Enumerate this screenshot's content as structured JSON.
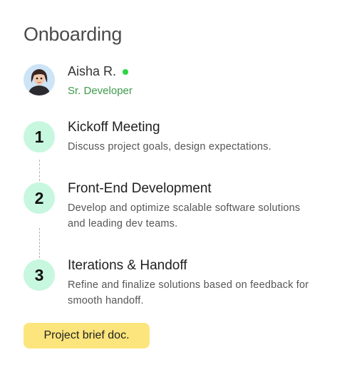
{
  "page": {
    "title": "Onboarding"
  },
  "user": {
    "name": "Aisha R.",
    "role": "Sr. Developer",
    "status": "online",
    "status_color": "#2bd63e",
    "role_color": "#3f9a4b"
  },
  "steps": [
    {
      "number": "1",
      "title": "Kickoff Meeting",
      "description": "Discuss project goals, design expectations."
    },
    {
      "number": "2",
      "title": "Front-End Development",
      "description": "Develop and optimize scalable software solutions and leading dev teams."
    },
    {
      "number": "3",
      "title": "Iterations & Handoff",
      "description": "Refine and finalize solutions based on feedback for smooth handoff."
    }
  ],
  "action": {
    "label": "Project brief doc."
  },
  "colors": {
    "badge_bg": "#c8f7df",
    "button_bg": "#fce57c"
  }
}
